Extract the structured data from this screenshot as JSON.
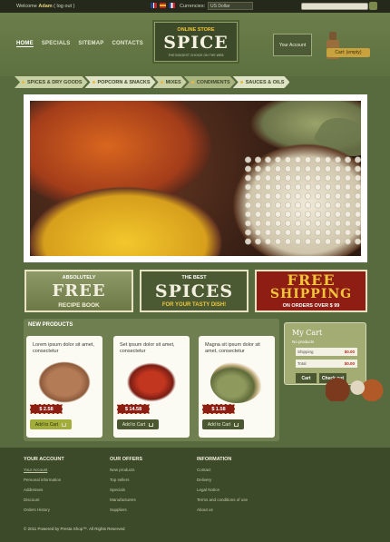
{
  "topbar": {
    "welcome_prefix": "Welcome",
    "welcome_name": "Adam",
    "welcome_suffix": "( log out )",
    "currency_label": "Currencies:",
    "currency_value": "US Dollar"
  },
  "header": {
    "nav": [
      "HOME",
      "SPECIALS",
      "SITEMAP",
      "CONTACTS"
    ],
    "logo_small": "ONLINE STORE",
    "logo_main": "SPICE",
    "logo_tagline": "THE BIGGEST CHOICE ON THE WEB",
    "account_button": "Your Account",
    "cart_button": "Cart: (empty)"
  },
  "categories": [
    "SPICES & DRY GOODS",
    "POPCORN & SNACKS",
    "MIXES",
    "CONDIMENTS",
    "SAUCES & OILS"
  ],
  "banners": {
    "b1": {
      "line1": "ABSOLUTELY",
      "line2": "FREE",
      "line3": "RECIPE BOOK"
    },
    "b2": {
      "line1": "THE BEST",
      "line2": "SPICES",
      "line3": "FOR YOUR TASTY DISH!"
    },
    "b3": {
      "line2": "FREE",
      "line2b": "SHIPPING",
      "line3": "ON ORDERS OVER $ 99"
    }
  },
  "products": {
    "title": "NEW PRODUCTS",
    "items": [
      {
        "name": "Lorem ipsum dolor sit amet, consectetur",
        "price": "$ 2.58",
        "button": "Add to Cart"
      },
      {
        "name": "Set ipsum dolor sit amet, consectetur",
        "price": "$ 14.58",
        "button": "Add to Cart"
      },
      {
        "name": "Magna sit ipsum dolor sit amet, consectetur",
        "price": "$ 1.58",
        "button": "Add to Cart"
      }
    ]
  },
  "cart": {
    "title": "My Cart",
    "empty_text": "No products",
    "shipping_label": "Shipping",
    "shipping_value": "$0.00",
    "total_label": "Total",
    "total_value": "$0.00",
    "cart_button": "Cart",
    "checkout_button": "Check out"
  },
  "footer": {
    "account": {
      "title": "YOUR ACCOUNT",
      "links": [
        "Your Account",
        "Personal information",
        "Addresses",
        "Discount",
        "Orders History"
      ]
    },
    "offers": {
      "title": "OUR OFFERS",
      "links": [
        "New products",
        "Top sellers",
        "Specials",
        "Manufacturers",
        "Suppliers"
      ]
    },
    "information": {
      "title": "INFORMATION",
      "links": [
        "Contact",
        "Delivery",
        "Legal Notice",
        "Terms and conditions of use",
        "About us"
      ]
    },
    "copyright": "© 2011 Powered by Presta Shop™. All Rights Reserved"
  },
  "colors": {
    "background": "#586b3f",
    "topbar": "#24291c",
    "accent_gold": "#f0c63a",
    "price_red": "#8c1e13",
    "footer": "#3d4a2a"
  }
}
